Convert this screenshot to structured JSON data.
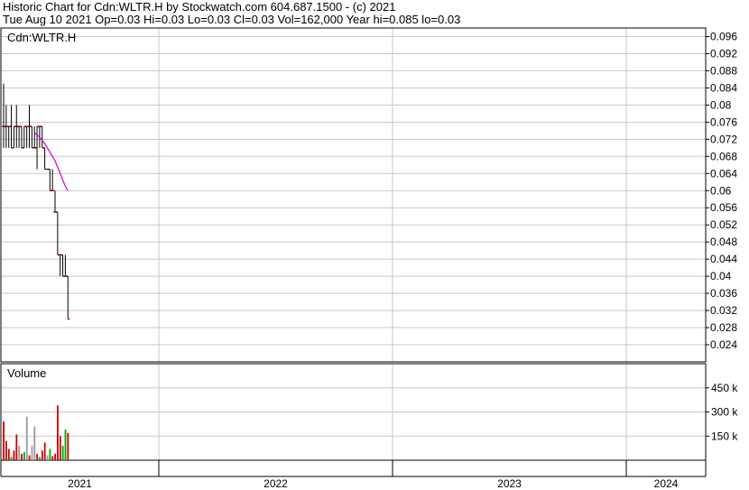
{
  "header": {
    "line1": "Historic Chart for Cdn:WLTR.H by Stockwatch.com 604.687.1500 - (c) 2021",
    "line2": "Tue Aug 10 2021  Op=0.03  Hi=0.03  Lo=0.03  Cl=0.03  Vol=162,000  Year hi=0.085  lo=0.03"
  },
  "chart_data": [
    {
      "type": "ohlc",
      "title": "Cdn:WLTR.H",
      "ylim": [
        0.02,
        0.098
      ],
      "y_ticks": [
        "0.096",
        "0.092",
        "0.088",
        "0.084",
        "0.08",
        "0.076",
        "0.072",
        "0.068",
        "0.064",
        "0.06",
        "0.056",
        "0.052",
        "0.048",
        "0.044",
        "0.04",
        "0.036",
        "0.032",
        "0.028",
        "0.024"
      ],
      "x_ticks": [
        "2021",
        "2022",
        "2023",
        "2024"
      ],
      "grid": true,
      "series": [
        {
          "kind": "ohlc",
          "x": [
            0,
            1,
            2,
            3,
            4,
            5,
            6,
            7,
            8,
            9,
            10,
            11,
            12,
            13,
            14,
            15,
            16,
            17,
            18,
            19,
            20,
            21,
            22,
            23,
            24,
            25
          ],
          "open": [
            0.075,
            0.075,
            0.075,
            0.075,
            0.07,
            0.075,
            0.075,
            0.075,
            0.07,
            0.075,
            0.075,
            0.075,
            0.07,
            0.07,
            0.075,
            0.075,
            0.07,
            0.065,
            0.065,
            0.06,
            0.055,
            0.055,
            0.045,
            0.045,
            0.04,
            0.04
          ],
          "high": [
            0.085,
            0.08,
            0.075,
            0.08,
            0.075,
            0.08,
            0.075,
            0.075,
            0.075,
            0.075,
            0.08,
            0.075,
            0.075,
            0.075,
            0.075,
            0.075,
            0.07,
            0.065,
            0.065,
            0.065,
            0.06,
            0.055,
            0.045,
            0.045,
            0.045,
            0.04
          ],
          "low": [
            0.07,
            0.07,
            0.07,
            0.07,
            0.07,
            0.07,
            0.07,
            0.07,
            0.07,
            0.07,
            0.07,
            0.07,
            0.07,
            0.065,
            0.07,
            0.07,
            0.065,
            0.065,
            0.06,
            0.06,
            0.055,
            0.045,
            0.04,
            0.04,
            0.04,
            0.03
          ],
          "close": [
            0.075,
            0.075,
            0.075,
            0.07,
            0.075,
            0.075,
            0.075,
            0.07,
            0.075,
            0.075,
            0.075,
            0.07,
            0.07,
            0.075,
            0.075,
            0.07,
            0.065,
            0.065,
            0.06,
            0.06,
            0.055,
            0.045,
            0.045,
            0.04,
            0.04,
            0.03
          ],
          "color": "#000000",
          "close_tick_color": "#cc0000"
        },
        {
          "kind": "line",
          "x": [
            12,
            14,
            16,
            18,
            20,
            22,
            24,
            25
          ],
          "y": [
            0.0735,
            0.0725,
            0.071,
            0.069,
            0.067,
            0.064,
            0.061,
            0.06
          ],
          "color": "#cc00cc"
        }
      ]
    },
    {
      "type": "bar",
      "title": "Volume",
      "ylim": [
        0,
        600
      ],
      "y_ticks": [
        "450 k",
        "300 k",
        "150 k"
      ],
      "y_tick_values": [
        450,
        300,
        150
      ],
      "grid": true,
      "values": [
        240,
        120,
        70,
        20,
        60,
        160,
        90,
        40,
        50,
        270,
        30,
        90,
        210,
        40,
        20,
        60,
        110,
        30,
        70,
        25,
        40,
        340,
        150,
        90,
        190,
        170
      ],
      "colors": [
        "#cc0000",
        "#cc0000",
        "#cc0000",
        "#00aa00",
        "#cc0000",
        "#cc0000",
        "#999999",
        "#cc0000",
        "#00aa00",
        "#999999",
        "#cc0000",
        "#999999",
        "#999999",
        "#cc0000",
        "#00aa00",
        "#cc0000",
        "#cc0000",
        "#999999",
        "#00aa00",
        "#cc0000",
        "#cc0000",
        "#cc0000",
        "#cc0000",
        "#00aa00",
        "#00aa00",
        "#cc0000"
      ]
    }
  ]
}
